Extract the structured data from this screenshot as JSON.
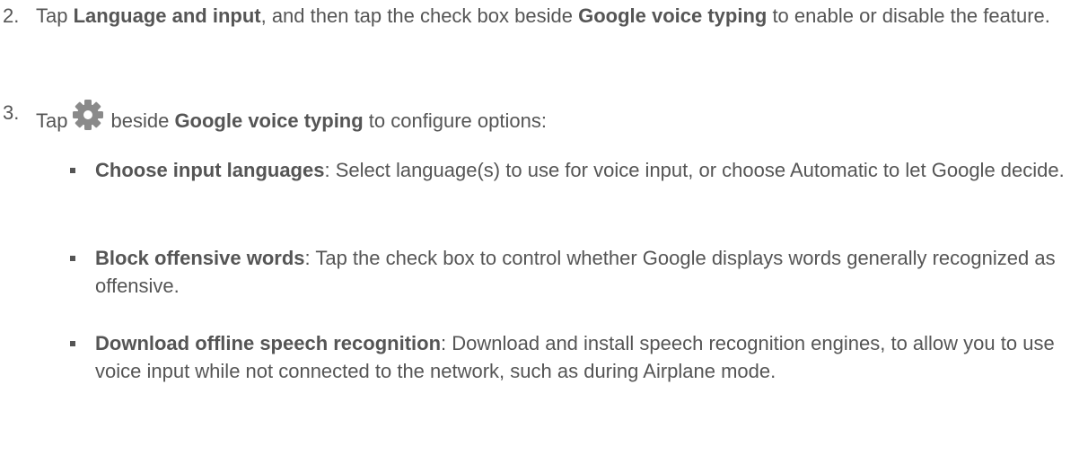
{
  "steps": [
    {
      "number": "2.",
      "parts": [
        "Tap ",
        "Language and input",
        ", and then tap the check box beside ",
        "Google voice typing",
        " to enable or disable the feature."
      ]
    },
    {
      "number": "3.",
      "parts": [
        "Tap",
        "beside ",
        "Google voice typing",
        " to configure options:"
      ],
      "icon": "gear-icon"
    }
  ],
  "options": [
    {
      "term": "Choose input languages",
      "description": ": Select language(s) to use for voice input, or choose Automatic to let Google decide."
    },
    {
      "term": "Block offensive words",
      "description": ": Tap the check box to control whether Google displays words generally recognized as offensive."
    },
    {
      "term": "Download offline speech recognition",
      "description": ": Download and install speech recognition engines, to allow you to use voice input while not connected to the network, such as during Airplane mode."
    }
  ],
  "colors": {
    "text": "#555555",
    "icon": "#8a8a8a"
  }
}
